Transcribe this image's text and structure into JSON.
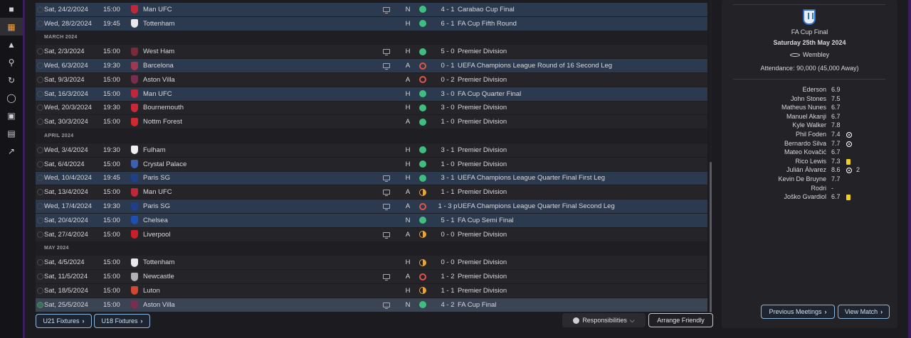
{
  "nav": [
    "home-icon",
    "calendar-icon",
    "trophy-icon",
    "search-icon",
    "transfer-icon",
    "shield-icon",
    "briefcase-icon",
    "cards-icon",
    "trend-icon"
  ],
  "fixtures": [
    {
      "type": "match",
      "date": "Sat, 24/2/2024",
      "time": "15:00",
      "opponent": "Man UFC",
      "badge": "#c0283a",
      "tv": true,
      "venue": "N",
      "result": "w",
      "score": "4 - 1",
      "competition": "Carabao Cup Final",
      "hl": true
    },
    {
      "type": "match",
      "date": "Wed, 28/2/2024",
      "time": "19:45",
      "opponent": "Tottenham",
      "badge": "#e8e8ee",
      "tv": false,
      "venue": "H",
      "result": "w",
      "score": "6 - 1",
      "competition": "FA Cup Fifth Round",
      "hl": true
    },
    {
      "type": "month",
      "label": "MARCH 2024"
    },
    {
      "type": "match",
      "date": "Sat, 2/3/2024",
      "time": "15:00",
      "opponent": "West Ham",
      "badge": "#7a2a3a",
      "tv": true,
      "venue": "H",
      "result": "w",
      "score": "5 - 0",
      "competition": "Premier Division",
      "hl": false
    },
    {
      "type": "match",
      "date": "Wed, 6/3/2024",
      "time": "19:30",
      "opponent": "Barcelona",
      "badge": "#a03850",
      "tv": true,
      "venue": "A",
      "result": "l",
      "score": "0 - 1",
      "competition": "UEFA Champions League Round of 16  Second Leg",
      "hl": true
    },
    {
      "type": "match",
      "date": "Sat, 9/3/2024",
      "time": "15:00",
      "opponent": "Aston Villa",
      "badge": "#7a2d4d",
      "tv": false,
      "venue": "A",
      "result": "l",
      "score": "0 - 2",
      "competition": "Premier Division",
      "hl": false
    },
    {
      "type": "match",
      "date": "Sat, 16/3/2024",
      "time": "15:00",
      "opponent": "Man UFC",
      "badge": "#c0283a",
      "tv": false,
      "venue": "H",
      "result": "w",
      "score": "3 - 0",
      "competition": "FA Cup Quarter Final",
      "hl": true
    },
    {
      "type": "match",
      "date": "Wed, 20/3/2024",
      "time": "19:30",
      "opponent": "Bournemouth",
      "badge": "#c8283a",
      "tv": false,
      "venue": "H",
      "result": "w",
      "score": "3 - 0",
      "competition": "Premier Division",
      "hl": false
    },
    {
      "type": "match",
      "date": "Sat, 30/3/2024",
      "time": "15:00",
      "opponent": "Nottm Forest",
      "badge": "#d02a30",
      "tv": false,
      "venue": "A",
      "result": "w",
      "score": "1 - 0",
      "competition": "Premier Division",
      "hl": false
    },
    {
      "type": "month",
      "label": "APRIL 2024"
    },
    {
      "type": "match",
      "date": "Wed, 3/4/2024",
      "time": "19:30",
      "opponent": "Fulham",
      "badge": "#f0f0f0",
      "tv": false,
      "venue": "H",
      "result": "w",
      "score": "3 - 1",
      "competition": "Premier Division",
      "hl": false
    },
    {
      "type": "match",
      "date": "Sat, 6/4/2024",
      "time": "15:00",
      "opponent": "Crystal Palace",
      "badge": "#3d5fb0",
      "tv": false,
      "venue": "H",
      "result": "w",
      "score": "1 - 0",
      "competition": "Premier Division",
      "hl": false
    },
    {
      "type": "match",
      "date": "Wed, 10/4/2024",
      "time": "19:45",
      "opponent": "Paris SG",
      "badge": "#1f3f8a",
      "tv": true,
      "venue": "H",
      "result": "w",
      "score": "3 - 1",
      "competition": "UEFA Champions League Quarter Final First Leg",
      "hl": true
    },
    {
      "type": "match",
      "date": "Sat, 13/4/2024",
      "time": "15:00",
      "opponent": "Man UFC",
      "badge": "#c0283a",
      "tv": true,
      "venue": "A",
      "result": "d",
      "score": "1 - 1",
      "competition": "Premier Division",
      "hl": false
    },
    {
      "type": "match",
      "date": "Wed, 17/4/2024",
      "time": "19:30",
      "opponent": "Paris SG",
      "badge": "#1f3f8a",
      "tv": true,
      "venue": "A",
      "result": "l",
      "score": "1 - 3 p",
      "competition": "UEFA Champions League Quarter Final Second Leg",
      "hl": true
    },
    {
      "type": "match",
      "date": "Sat, 20/4/2024",
      "time": "15:00",
      "opponent": "Chelsea",
      "badge": "#1f4fb0",
      "tv": false,
      "venue": "N",
      "result": "w",
      "score": "5 - 1",
      "competition": "FA Cup Semi Final",
      "hl": true
    },
    {
      "type": "match",
      "date": "Sat, 27/4/2024",
      "time": "15:00",
      "opponent": "Liverpool",
      "badge": "#c8202a",
      "tv": true,
      "venue": "A",
      "result": "d",
      "score": "0 - 0",
      "competition": "Premier Division",
      "hl": false
    },
    {
      "type": "month",
      "label": "MAY 2024"
    },
    {
      "type": "match",
      "date": "Sat, 4/5/2024",
      "time": "15:00",
      "opponent": "Tottenham",
      "badge": "#e8e8ee",
      "tv": false,
      "venue": "H",
      "result": "d",
      "score": "0 - 0",
      "competition": "Premier Division",
      "hl": false
    },
    {
      "type": "match",
      "date": "Sat, 11/5/2024",
      "time": "15:00",
      "opponent": "Newcastle",
      "badge": "#b0b0b6",
      "tv": true,
      "venue": "A",
      "result": "l",
      "score": "1 - 2",
      "competition": "Premier Division",
      "hl": false
    },
    {
      "type": "match",
      "date": "Sat, 18/5/2024",
      "time": "15:00",
      "opponent": "Luton",
      "badge": "#d04830",
      "tv": false,
      "venue": "H",
      "result": "d",
      "score": "1 - 1",
      "competition": "Premier Division",
      "hl": false
    },
    {
      "type": "match",
      "date": "Sat, 25/5/2024",
      "time": "15:00",
      "opponent": "Aston Villa",
      "badge": "#7a2d4d",
      "tv": true,
      "venue": "N",
      "result": "w",
      "score": "4 - 2",
      "competition": "FA Cup Final",
      "hl": true,
      "selected": true
    }
  ],
  "buttons": {
    "u21": "U21 Fixtures",
    "u18": "U18 Fixtures",
    "responsibilities": "Responsibilities",
    "arrange": "Arrange Friendly",
    "previous_meetings": "Previous Meetings",
    "view_match": "View Match"
  },
  "match": {
    "competition": "FA Cup Final",
    "date": "Saturday 25th May 2024",
    "stadium": "Wembley",
    "attendance": "Attendance: 90,000 (45,000 Away)"
  },
  "lineup": [
    {
      "name": "Ederson",
      "rating": "6.9",
      "event": ""
    },
    {
      "name": "John Stones",
      "rating": "7.5",
      "event": ""
    },
    {
      "name": "Matheus Nunes",
      "rating": "6.7",
      "event": ""
    },
    {
      "name": "Manuel Akanji",
      "rating": "6.7",
      "event": ""
    },
    {
      "name": "Kyle Walker",
      "rating": "7.8",
      "event": ""
    },
    {
      "name": "Phil Foden",
      "rating": "7.4",
      "event": "goal"
    },
    {
      "name": "Bernardo Silva",
      "rating": "7.7",
      "event": "goal"
    },
    {
      "name": "Mateo Kovačić",
      "rating": "6.7",
      "event": ""
    },
    {
      "name": "Rico Lewis",
      "rating": "7.3",
      "event": "yellow"
    },
    {
      "name": "Julián Álvarez",
      "rating": "8.6",
      "event": "goal",
      "goals": "2"
    },
    {
      "name": "Kevin De Bruyne",
      "rating": "7.7",
      "event": ""
    },
    {
      "name": "Rodri",
      "rating": "-",
      "event": ""
    },
    {
      "name": "Joško Gvardiol",
      "rating": "6.7",
      "event": "yellow"
    }
  ]
}
